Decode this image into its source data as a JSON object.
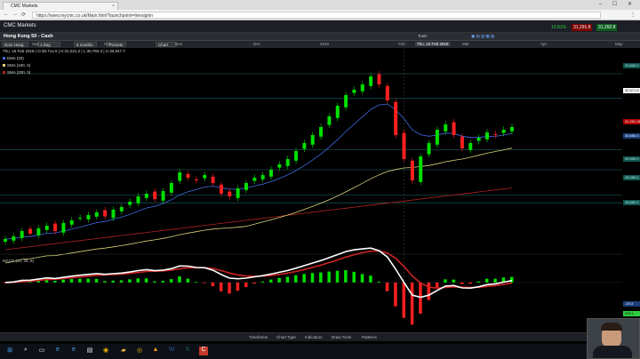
{
  "browser": {
    "tab_title": "CMC Markets",
    "url": "https://www.mycmc.co.uk/Main.html?launchpoint=livesignin",
    "close_glyph": "×",
    "back_glyph": "←",
    "forward_glyph": "→",
    "reload_glyph": "⟳",
    "menu_glyph": "⋮",
    "window_controls": "– ☐ ✕"
  },
  "app": {
    "title": "CMC Markets",
    "quotes": [
      {
        "text": "10.81%",
        "color": "#2ecc40"
      },
      {
        "text": "31,291.8",
        "color": "#ff4136"
      },
      {
        "text": "31,292.8",
        "color": "#2ecc40"
      }
    ]
  },
  "instrument": {
    "title": "Hong Kong 50 - Cash",
    "tools_label": "Tools",
    "date_cursor": "Thu, 15 Feb 2018"
  },
  "toolbar": {
    "asset_label": "Dom Hong",
    "interval_label": "1 Day",
    "period_label": "6 months",
    "presets_label": "Presets",
    "chart_pin_label": "Chart Pinner"
  },
  "x_axis_labels": [
    "Sep",
    "Oct",
    "Nov",
    "Dec",
    "2018",
    "Feb",
    "Mar",
    "Apr",
    "May"
  ],
  "price_info": {
    "ohlc_line": "Thu, 15 Feb 2018 | O:30,714.6 | H:31,031.2 | L:30,750.3 | C:30,947.7",
    "legend": [
      {
        "text": "EMA (20)",
        "color": "#4169e1"
      },
      {
        "text": "SMA (100, 0)",
        "color": "#d8d27a"
      },
      {
        "text": "SMA (200, 0)",
        "color": "#b22222"
      }
    ]
  },
  "price_tags": [
    {
      "text": "33,500.0",
      "color": "#0e5550"
    },
    {
      "text": "32,571.8",
      "color": "#ffffff"
    },
    {
      "text": "31,291.38",
      "color": "#b30000"
    },
    {
      "text": "30,650.0",
      "color": "#1a3f7a"
    },
    {
      "text": "29,900.0",
      "color": "#0e5550"
    },
    {
      "text": "28,950.0",
      "color": "#0e5550"
    },
    {
      "text": "28,662.0",
      "color": "#0e5550"
    }
  ],
  "macd": {
    "label": "MACD (12, 26, 9)",
    "value_tags": [
      {
        "text": "-19.3",
        "color": "#1a3f7a"
      },
      {
        "text": "249.1",
        "color": "#2ecc40"
      }
    ]
  },
  "bottom_tabs": [
    "Timeframe",
    "Chart Type",
    "Indicators",
    "Draw Tools",
    "Patterns"
  ],
  "taskbar_icons": [
    "windows-icon",
    "search-icon",
    "task-view-icon",
    "edge-icon",
    "explorer-icon",
    "store-icon",
    "chrome-icon",
    "folder-icon",
    "word-icon",
    "excel-icon",
    "cmc-icon"
  ],
  "colors": {
    "up": "#00e000",
    "down": "#ff2020",
    "ema": "#4169e1",
    "sma100": "#d8d27a",
    "sma200": "#b22222",
    "macd_line": "#ffffff",
    "macd_signal": "#cc2222"
  },
  "chart_data": {
    "type": "candlestick",
    "title": "Hong Kong 50 - Cash",
    "x_range": [
      "2017-09",
      "2018-05"
    ],
    "close_series": [
      27300,
      27400,
      27600,
      27500,
      27700,
      27800,
      27600,
      27900,
      28000,
      28100,
      28200,
      28300,
      28150,
      28400,
      28500,
      28700,
      28900,
      29000,
      28800,
      29100,
      29400,
      29800,
      29600,
      29500,
      29700,
      29400,
      29000,
      28900,
      29200,
      29400,
      29600,
      29700,
      29900,
      30100,
      30300,
      30600,
      30900,
      31200,
      31500,
      31900,
      32300,
      32700,
      32900,
      33100,
      33400,
      33100,
      32500,
      31200,
      30300,
      29500,
      30400,
      30900,
      31400,
      31600,
      31200,
      30700,
      30900,
      31100,
      31300,
      31200,
      31400,
      31500
    ]
  }
}
